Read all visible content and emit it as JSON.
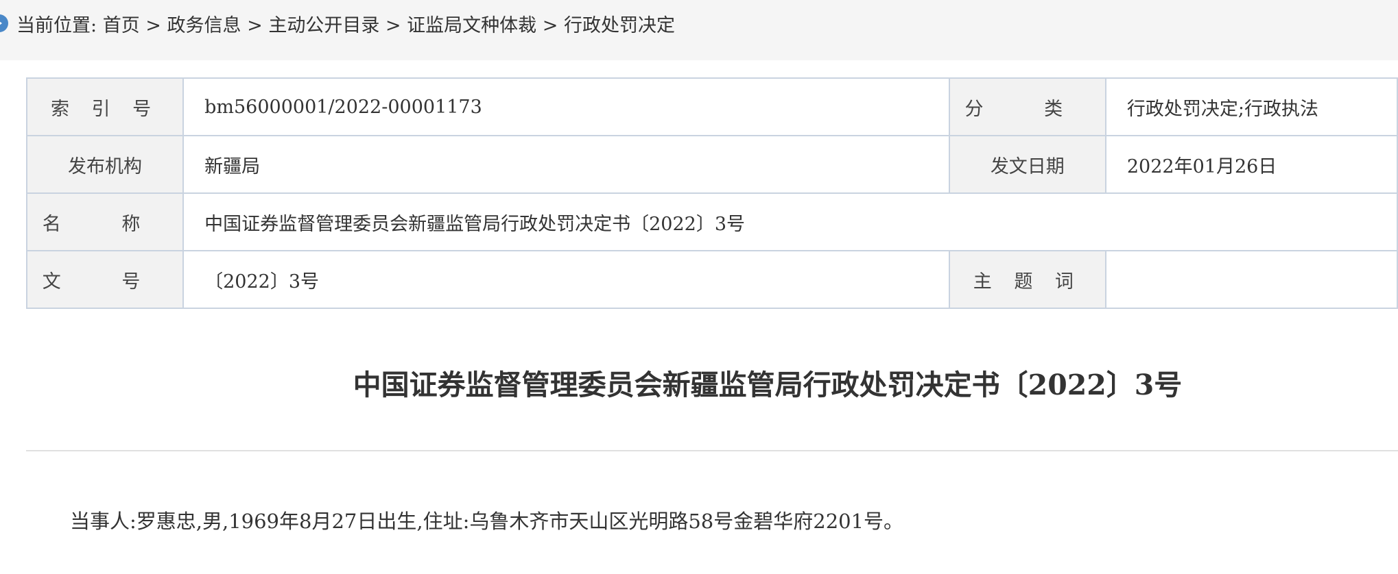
{
  "breadcrumb": {
    "prefix": "当前位置:",
    "items": [
      "首页",
      "政务信息",
      "主动公开目录",
      "证监局文种体裁",
      "行政处罚决定"
    ],
    "separator": ">"
  },
  "meta": {
    "index_label": "索 引 号",
    "index_value": "bm56000001/2022-00001173",
    "category_label": "分 类",
    "category_value": "行政处罚决定;行政执法",
    "publisher_label": "发布机构",
    "publisher_value": "新疆局",
    "date_label": "发文日期",
    "date_value": "2022年01月26日",
    "name_label": "名 称",
    "name_value": "中国证券监督管理委员会新疆监管局行政处罚决定书〔2022〕3号",
    "docno_label": "文 号",
    "docno_value": "〔2022〕3号",
    "keywords_label": "主 题 词",
    "keywords_value": ""
  },
  "document": {
    "title": "中国证券监督管理委员会新疆监管局行政处罚决定书〔2022〕3号",
    "party_line": "当事人:罗惠忠,男,1969年8月27日出生,住址:乌鲁木齐市天山区光明路58号金碧华府2201号。"
  }
}
